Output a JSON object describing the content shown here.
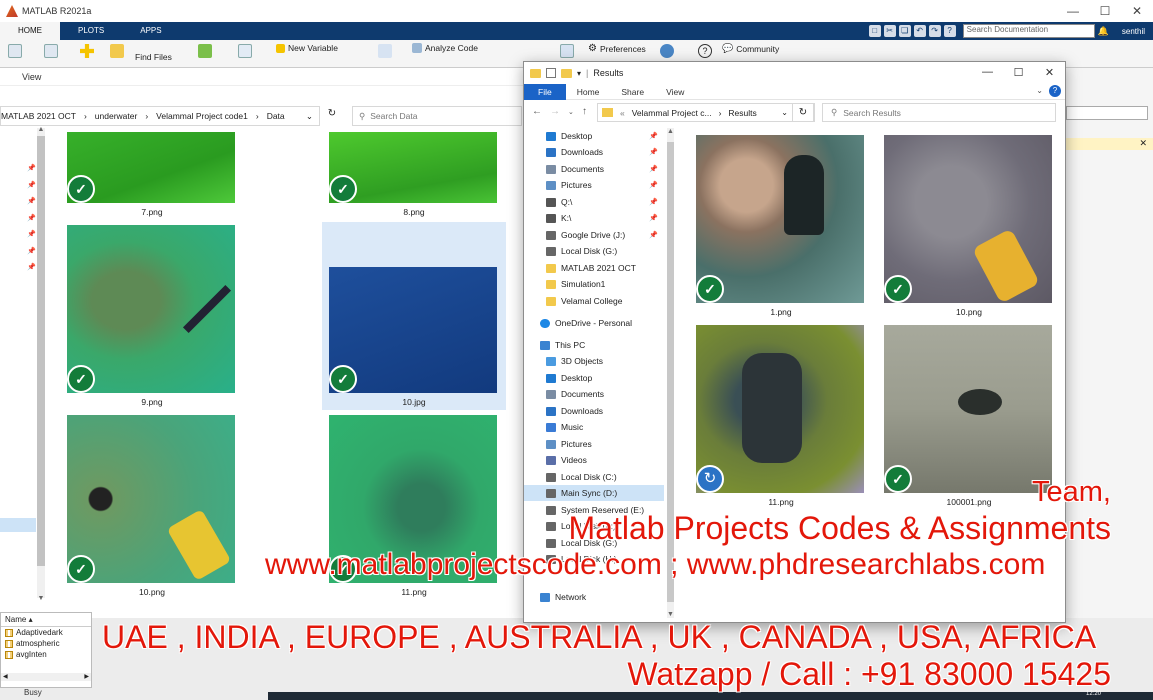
{
  "matlab": {
    "title": "MATLAB R2021a",
    "tabs": [
      "HOME",
      "PLOTS",
      "APPS"
    ],
    "search_placeholder": "Search Documentation",
    "user": "senthil",
    "toolstrip": {
      "find_files": "Find Files",
      "new_variable": "New Variable",
      "analyze_code": "Analyze Code",
      "preferences": "Preferences",
      "community": "Community"
    },
    "workspace": {
      "header": "Name ▴",
      "rows": [
        "Adaptivedark",
        "atmospheric",
        "avgInten"
      ]
    },
    "status": "Busy"
  },
  "data_explorer": {
    "ribbon_view": "View",
    "breadcrumb": [
      "MATLAB 2021 OCT",
      "underwater",
      "Velammal Project code1",
      "Data"
    ],
    "search_placeholder": "Search Data",
    "thumbnails": [
      {
        "name": "7.png"
      },
      {
        "name": "8.png"
      },
      {
        "name": "9.png"
      },
      {
        "name": "10.jpg"
      },
      {
        "name": "10.png"
      },
      {
        "name": "11.png"
      }
    ]
  },
  "results_explorer": {
    "title": "Results",
    "ribbon": {
      "file": "File",
      "home": "Home",
      "share": "Share",
      "view": "View"
    },
    "breadcrumb": [
      "Velammal Project c...",
      "Results"
    ],
    "search_placeholder": "Search Results",
    "nav": {
      "quick": [
        {
          "label": "Desktop",
          "icon": "desktop-icon",
          "color": "#1f7ad1",
          "pinned": true
        },
        {
          "label": "Downloads",
          "icon": "download-icon",
          "color": "#2b73c5",
          "pinned": true
        },
        {
          "label": "Documents",
          "icon": "document-icon",
          "color": "#7a8ca3",
          "pinned": true
        },
        {
          "label": "Pictures",
          "icon": "picture-icon",
          "color": "#5d8fc5",
          "pinned": true
        },
        {
          "label": "Q:\\",
          "icon": "network-drive-icon",
          "color": "#555555",
          "pinned": true
        },
        {
          "label": "K:\\",
          "icon": "network-drive-icon",
          "color": "#555555",
          "pinned": true
        },
        {
          "label": "Google Drive (J:)",
          "icon": "drive-icon",
          "color": "#666666",
          "pinned": true
        },
        {
          "label": "Local Disk (G:)",
          "icon": "drive-icon",
          "color": "#666666",
          "pinned": false
        },
        {
          "label": "MATLAB 2021 OCT",
          "icon": "folder-icon",
          "color": "#f2c94c",
          "pinned": false
        },
        {
          "label": "Simulation1",
          "icon": "folder-icon",
          "color": "#f2c94c",
          "pinned": false
        },
        {
          "label": "Velamal College",
          "icon": "folder-icon",
          "color": "#f2c94c",
          "pinned": false
        }
      ],
      "onedrive": "OneDrive - Personal",
      "this_pc": "This PC",
      "pc_items": [
        {
          "label": "3D Objects",
          "icon": "cube-icon",
          "color": "#4a9be0"
        },
        {
          "label": "Desktop",
          "icon": "desktop-icon",
          "color": "#1f7ad1"
        },
        {
          "label": "Documents",
          "icon": "document-icon",
          "color": "#7a8ca3"
        },
        {
          "label": "Downloads",
          "icon": "download-icon",
          "color": "#2b73c5"
        },
        {
          "label": "Music",
          "icon": "music-icon",
          "color": "#3a7bd5"
        },
        {
          "label": "Pictures",
          "icon": "picture-icon",
          "color": "#5d8fc5"
        },
        {
          "label": "Videos",
          "icon": "video-icon",
          "color": "#5a6ea8"
        },
        {
          "label": "Local Disk (C:)",
          "icon": "drive-icon",
          "color": "#666666"
        },
        {
          "label": "Main Sync (D:)",
          "icon": "drive-icon",
          "color": "#666666",
          "selected": true
        },
        {
          "label": "System Reserved (E:)",
          "icon": "drive-icon",
          "color": "#666666"
        },
        {
          "label": "Local Disk (F:)",
          "icon": "drive-icon",
          "color": "#666666"
        },
        {
          "label": "Local Disk (G:)",
          "icon": "drive-icon",
          "color": "#666666"
        },
        {
          "label": "Local Disk (H:)",
          "icon": "drive-icon",
          "color": "#666666"
        }
      ],
      "network": "Network"
    },
    "files": [
      {
        "name": "1.png",
        "status": "synced"
      },
      {
        "name": "10.png",
        "status": "synced"
      },
      {
        "name": "11.png",
        "status": "syncing"
      },
      {
        "name": "100001.png",
        "status": "synced"
      }
    ]
  },
  "overlay": {
    "team": "Team,",
    "codes": "Matlab Projects Codes & Assignments",
    "websites": "www.matlabprojectscode.com ; www.phdresearchlabs.com",
    "countries": "UAE , INDIA , EUROPE , AUSTRALIA , UK , CANADA , USA, AFRICA",
    "contact": "Watzapp / Call : +91 83000 15425"
  },
  "taskbar": {
    "time": "12:20"
  },
  "colors": {
    "accent": "#1a63c7",
    "matlab_bar": "#0e3a6e",
    "overlay_red": "#e3170a",
    "sync_green": "#137c3a"
  }
}
